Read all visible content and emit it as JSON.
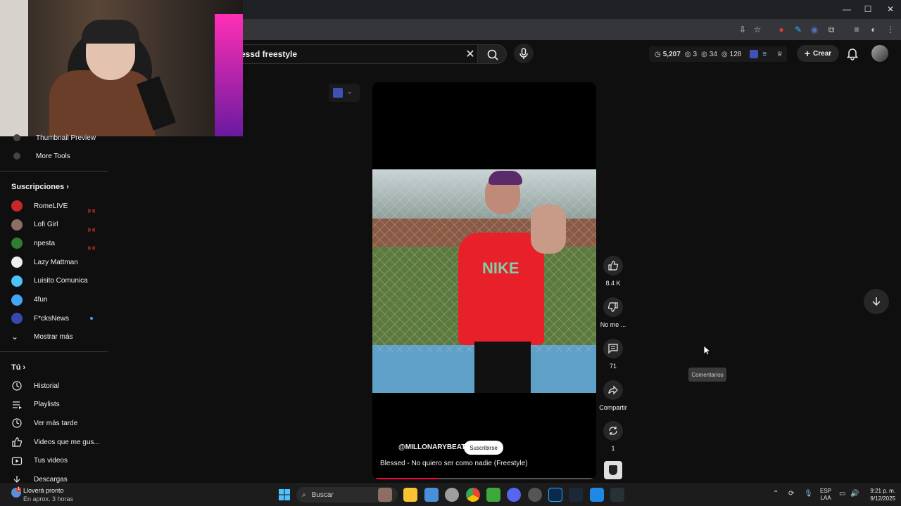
{
  "browser": {
    "window_controls": [
      "—",
      "☐",
      "✕"
    ]
  },
  "search": {
    "query": "essd freestyle"
  },
  "stats": {
    "time": "5,207",
    "a": "3",
    "b": "34",
    "c": "128"
  },
  "header": {
    "create_label": "Crear"
  },
  "sidebar": {
    "top_items": [
      {
        "label": "Thumbnail Preview"
      },
      {
        "label": "More Tools"
      }
    ],
    "subs_heading": "Suscripciones",
    "subscriptions": [
      {
        "label": "RomeLIVE",
        "color": "#c62828",
        "live": true
      },
      {
        "label": "Lofi Girl",
        "color": "#8d6e63",
        "live": true
      },
      {
        "label": "npesta",
        "color": "#2e7d32",
        "live": true
      },
      {
        "label": "Lazy Mattman",
        "color": "#eeeeee",
        "live": false
      },
      {
        "label": "Luisito Comunica",
        "color": "#4fc3f7",
        "live": false
      },
      {
        "label": "4fun",
        "color": "#42a5f5",
        "live": false
      },
      {
        "label": "F*cksNews",
        "color": "#3949ab",
        "live": false,
        "dot": true
      }
    ],
    "show_more": "Mostrar más",
    "you_heading": "Tú",
    "you_items": [
      {
        "label": "Historial",
        "icon": "history-icon"
      },
      {
        "label": "Playlists",
        "icon": "playlist-icon"
      },
      {
        "label": "Ver más tarde",
        "icon": "clock-icon"
      },
      {
        "label": "Videos que me gus...",
        "icon": "thumbs-up-icon"
      },
      {
        "label": "Tus videos",
        "icon": "play-icon"
      },
      {
        "label": "Descargas",
        "icon": "download-icon"
      }
    ]
  },
  "video": {
    "channel": "@MILLONARYBEATS",
    "subscribe": "Suscribirse",
    "title": "Blessed - No quiero ser como nadie (Freestyle)",
    "progress": 0.29
  },
  "actions": {
    "likes": "8.4 K",
    "dislike": "No me ...",
    "comments": "71",
    "share": "Compartir",
    "remix": "1"
  },
  "tooltip": "Comentarios",
  "taskbar": {
    "weather_title": "Lloverá pronto",
    "weather_sub": "En aprox. 3 horas",
    "search": "Buscar",
    "lang1": "ESP",
    "lang2": "LAA",
    "time": "9:21 p. m.",
    "date": "9/12/2025"
  }
}
